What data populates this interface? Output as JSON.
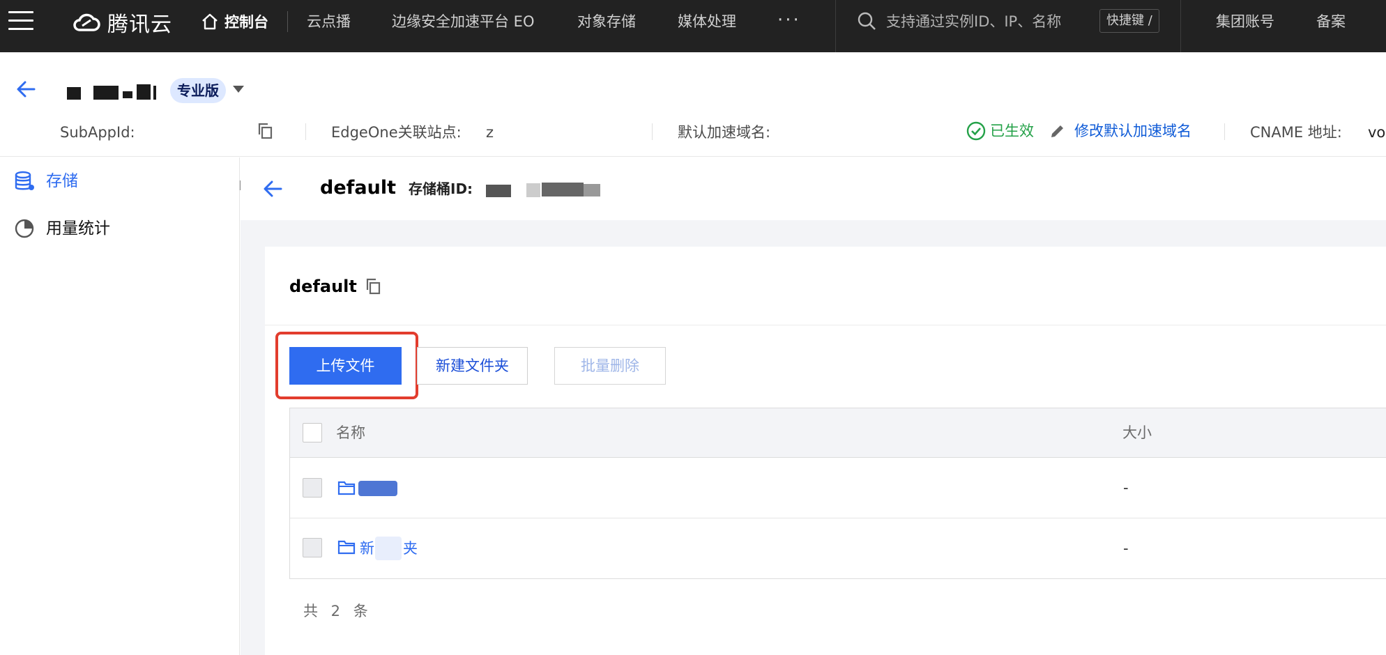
{
  "topbar": {
    "brand": "腾讯云",
    "console": "控制台",
    "nav": [
      "云点播",
      "边缘安全加速平台 EO",
      "对象存储",
      "媒体处理"
    ],
    "more": "···",
    "search_placeholder": "支持通过实例ID、IP、名称",
    "shortcut": "快捷键 /",
    "right_links": [
      "集团账号",
      "备案"
    ]
  },
  "app": {
    "edition_badge": "专业版",
    "meta": {
      "subappid_label": "SubAppId:",
      "edgeone_label": "EdgeOne关联站点:",
      "edgeone_value_prefix": "z",
      "default_domain_label": "默认加速域名:",
      "status": "已生效",
      "edit_default_domain": "修改默认加速域名",
      "cname_label": "CNAME 地址:",
      "cname_value_prefix": "vo"
    }
  },
  "sidebar": {
    "items": [
      {
        "label": "存储",
        "icon": "database-icon",
        "active": true
      },
      {
        "label": "用量统计",
        "icon": "pie-chart-icon",
        "active": false
      }
    ]
  },
  "main": {
    "title": "default",
    "bucket_id_label": "存储桶ID:",
    "card_title": "default",
    "buttons": {
      "upload": "上传文件",
      "new_folder": "新建文件夹",
      "batch_delete": "批量删除"
    },
    "table": {
      "columns": [
        "名称",
        "大小"
      ],
      "rows": [
        {
          "name_visible": "",
          "size": "-"
        },
        {
          "name_visible": "新",
          "name_tail": "夹",
          "size": "-"
        }
      ]
    },
    "total": "共 2 条"
  },
  "colors": {
    "accent": "#2f6cf0",
    "link": "#0f5bd7",
    "success": "#24a148",
    "highlight": "#e23d2e"
  }
}
